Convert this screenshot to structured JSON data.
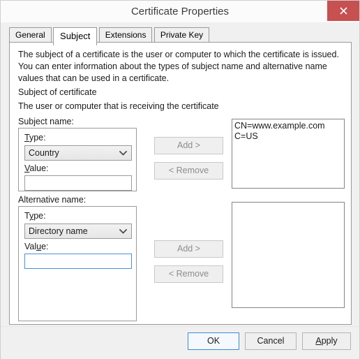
{
  "window": {
    "title": "Certificate Properties",
    "close_icon": "close-icon",
    "accent_close": "#c75050"
  },
  "tabs": [
    {
      "label": "General",
      "active": false
    },
    {
      "label": "Subject",
      "active": true
    },
    {
      "label": "Extensions",
      "active": false
    },
    {
      "label": "Private Key",
      "active": false
    }
  ],
  "page": {
    "description": "The subject of a certificate is the user or computer to which the certificate is issued. You can enter information about the types of subject name and alternative name values that can be used in a certificate.",
    "heading": "Subject of certificate",
    "subheading": "The user or computer that is receiving the certificate"
  },
  "subject_name": {
    "group_label": "Subject name:",
    "type_label_pre": "",
    "type_label_accel": "T",
    "type_label_post": "ype:",
    "type_value": "Country",
    "value_label_pre": "",
    "value_label_accel": "V",
    "value_label_post": "alue:",
    "value_text": "",
    "value_placeholder": "",
    "add_label": "Add >",
    "remove_label": "< Remove",
    "add_enabled": false,
    "remove_enabled": false,
    "list_items": [
      "CN=www.example.com",
      "C=US"
    ]
  },
  "alternative_name": {
    "group_label": "Alternative name:",
    "type_label_pre": "T",
    "type_label_accel": "y",
    "type_label_post": "pe:",
    "type_value": "Directory name",
    "value_label_pre": "Val",
    "value_label_accel": "u",
    "value_label_post": "e:",
    "value_text": "",
    "value_placeholder": "",
    "add_label": "Add >",
    "remove_label": "< Remove",
    "add_enabled": false,
    "remove_enabled": false,
    "list_items": []
  },
  "footer": {
    "ok_label": "OK",
    "cancel_label": "Cancel",
    "apply_label_pre": "",
    "apply_label_accel": "A",
    "apply_label_post": "pply"
  },
  "icons": {
    "chevron_down": "chevron-down-icon"
  }
}
